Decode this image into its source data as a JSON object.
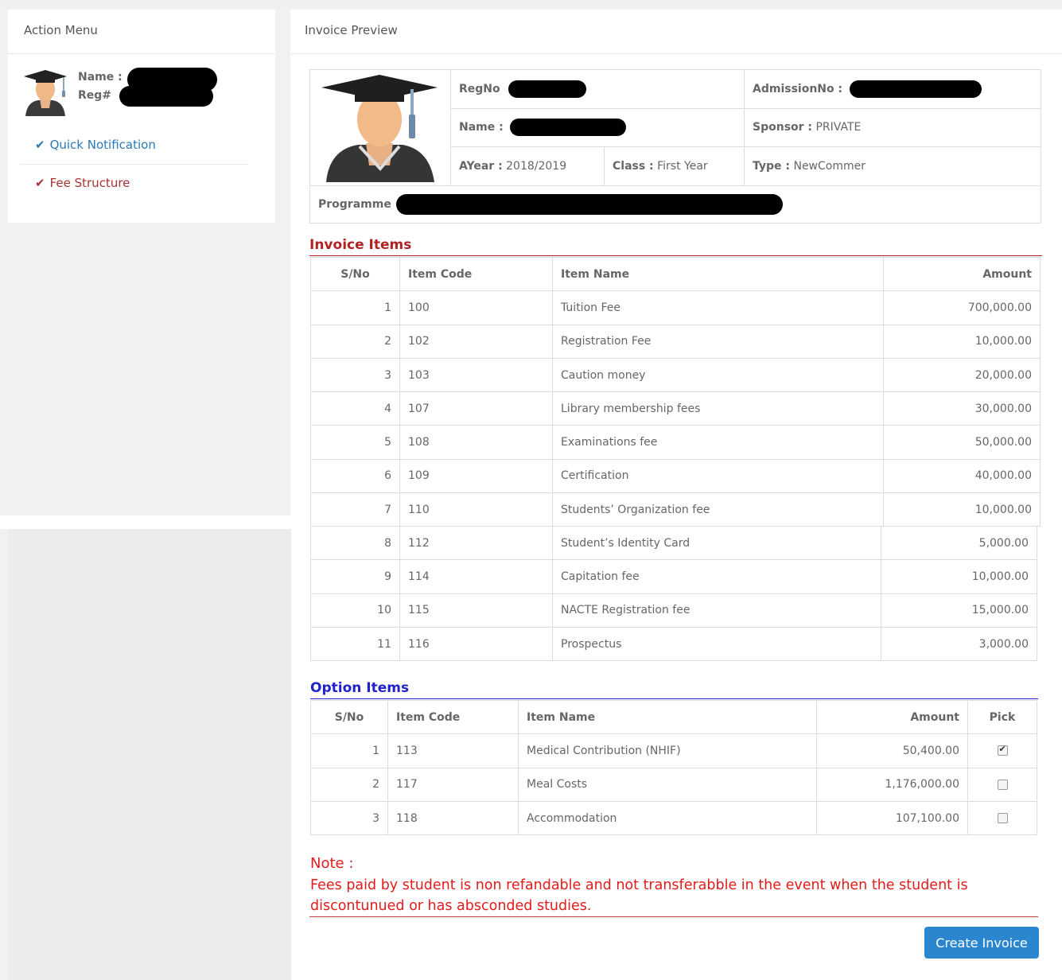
{
  "action_menu": {
    "title": "Action Menu",
    "name_label": "Name :",
    "reg_label": "Reg#",
    "items": [
      {
        "label": "Quick Notification",
        "color": "#2a7ab8"
      },
      {
        "label": "Fee Structure",
        "color": "#a83232"
      }
    ]
  },
  "invoice_preview": {
    "title": "Invoice Preview",
    "regno_label": "RegNo",
    "admission_label": "AdmissionNo :",
    "name_label": "Name :",
    "sponsor_label": "Sponsor :",
    "sponsor_value": "PRIVATE",
    "ayear_label": "AYear :",
    "ayear_value": "2018/2019",
    "class_label": "Class :",
    "class_value": "First Year",
    "type_label": "Type :",
    "type_value": "NewCommer",
    "programme_label": "Programme"
  },
  "invoice_items": {
    "title": "Invoice Items",
    "title_color": "#b22222",
    "headers": [
      "S/No",
      "Item Code",
      "Item Name",
      "Amount"
    ],
    "rows": [
      [
        "1",
        "100",
        "Tuition Fee",
        "700,000.00"
      ],
      [
        "2",
        "102",
        "Registration Fee",
        "10,000.00"
      ],
      [
        "3",
        "103",
        "Caution money",
        "20,000.00"
      ],
      [
        "4",
        "107",
        "Library membership fees",
        "30,000.00"
      ],
      [
        "5",
        "108",
        "Examinations fee",
        "50,000.00"
      ],
      [
        "6",
        "109",
        "Certification",
        "40,000.00"
      ],
      [
        "7",
        "110",
        "Students’ Organization fee",
        "10,000.00"
      ],
      [
        "8",
        "112",
        "Student’s Identity Card",
        "5,000.00"
      ],
      [
        "9",
        "114",
        "Capitation fee",
        "10,000.00"
      ],
      [
        "10",
        "115",
        "NACTE Registration fee",
        "15,000.00"
      ],
      [
        "11",
        "116",
        "Prospectus",
        "3,000.00"
      ]
    ]
  },
  "option_items": {
    "title": "Option Items",
    "title_color": "#2222cc",
    "headers": [
      "S/No",
      "Item Code",
      "Item Name",
      "Amount",
      "Pick"
    ],
    "rows": [
      {
        "sno": "1",
        "code": "113",
        "name": "Medical Contribution (NHIF)",
        "amount": "50,400.00",
        "picked": true
      },
      {
        "sno": "2",
        "code": "117",
        "name": "Meal Costs",
        "amount": "1,176,000.00",
        "picked": false
      },
      {
        "sno": "3",
        "code": "118",
        "name": "Accommodation",
        "amount": "107,100.00",
        "picked": false
      }
    ]
  },
  "note": {
    "title": "Note :",
    "text": "Fees paid by student is non refandable and not transferabble in the event when the student is discontunued or has absconded studies."
  },
  "create_button": "Create Invoice"
}
